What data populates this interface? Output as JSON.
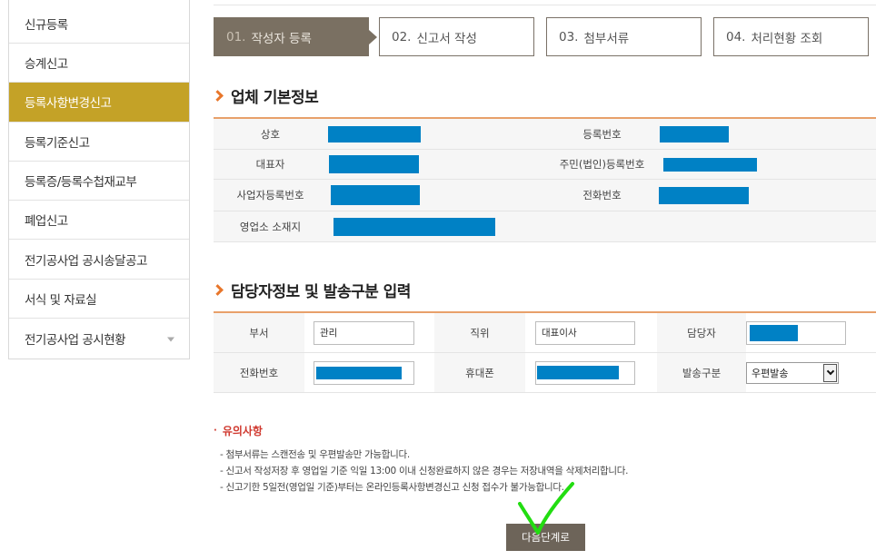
{
  "sidebar": {
    "items": [
      {
        "label": "신규등록"
      },
      {
        "label": "승계신고"
      },
      {
        "label": "등록사항변경신고"
      },
      {
        "label": "등록기준신고"
      },
      {
        "label": "등록증/등록수첩재교부"
      },
      {
        "label": "폐업신고"
      },
      {
        "label": "전기공사업 공시송달공고"
      },
      {
        "label": "서식 및 자료실"
      },
      {
        "label": "전기공사업 공시현황"
      }
    ],
    "active_index": 2
  },
  "steps": [
    {
      "num": "01.",
      "label": "작성자 등록"
    },
    {
      "num": "02.",
      "label": "신고서 작성"
    },
    {
      "num": "03.",
      "label": "첨부서류"
    },
    {
      "num": "04.",
      "label": "처리현황 조회"
    }
  ],
  "company_info": {
    "title": "업체 기본정보",
    "labels": {
      "company_name": "상호",
      "reg_no": "등록번호",
      "representative": "대표자",
      "resident_no": "주민(법인)등록번호",
      "biz_reg_no": "사업자등록번호",
      "phone": "전화번호",
      "address": "영업소 소재지"
    }
  },
  "contact_info": {
    "title": "담당자정보 및 발송구분 입력",
    "labels": {
      "dept": "부서",
      "position": "직위",
      "manager": "담당자",
      "phone": "전화번호",
      "mobile": "휴대폰",
      "delivery": "발송구분"
    },
    "values": {
      "dept": "관리",
      "position": "대표이사",
      "delivery": "우편발송"
    }
  },
  "notice": {
    "title": "유의사항",
    "lines": [
      "- 첨부서류는 스캔전송 및 우편발송만 가능합니다.",
      "- 신고서 작성저장 후 영업일 기준 익일 13:00 이내 신청완료하지 않은 경우는 저장내역을 삭제처리합니다.",
      "- 신고기한 5일전(영업일 기준)부터는 온라인등록사항변경신고 신청 접수가 불가능합니다."
    ]
  },
  "next_button": {
    "label": "다음단계로"
  },
  "colors": {
    "sidebar_active": "#c4a227",
    "step_active": "#7a7062",
    "accent_orange": "#e8762a",
    "redaction": "#0081c5",
    "notice_red": "#d0392f",
    "annotation_green": "#22dd11"
  }
}
